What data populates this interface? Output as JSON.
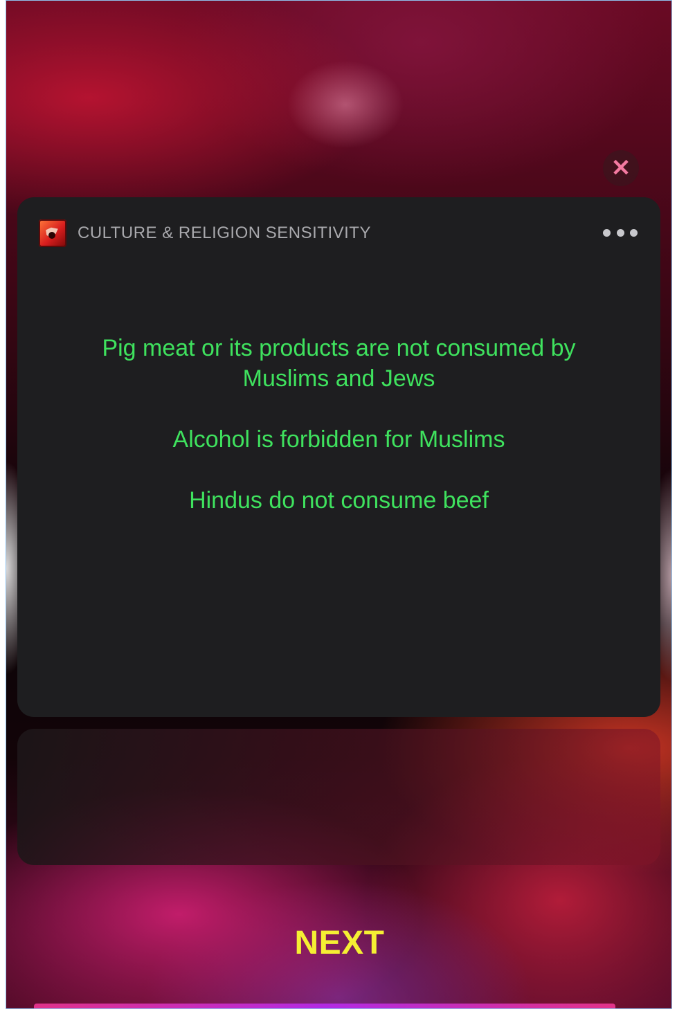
{
  "card": {
    "app_title": "CULTURE & RELIGION SENSITIVITY",
    "app_icon": "culture-religion-app-icon",
    "more_icon": "more-options-icon",
    "facts": [
      "Pig meat or its products are not consumed by Muslims and Jews",
      "Alcohol is forbidden for Muslims",
      "Hindus do not consume beef"
    ]
  },
  "close_icon": "close-icon",
  "next_label": "NEXT",
  "colors": {
    "fact_text": "#3fe25e",
    "next_text": "#f5ef33",
    "close_icon": "#f47aa1",
    "card_bg": "#1e1e20"
  }
}
